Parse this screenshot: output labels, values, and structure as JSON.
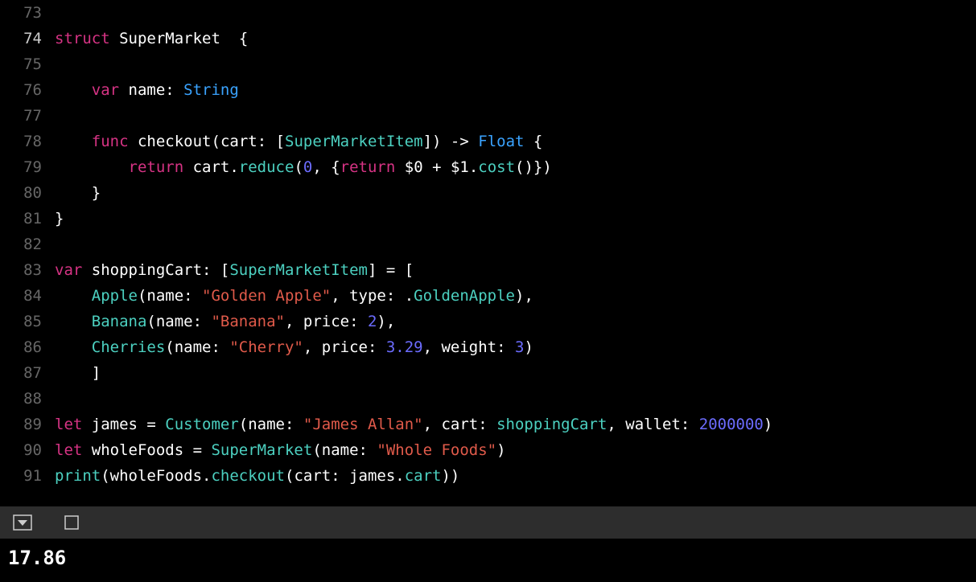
{
  "editor": {
    "first_line_no": 73,
    "lines": [
      {
        "no": 73,
        "tokens": []
      },
      {
        "no": 74,
        "tokens": [
          {
            "t": "struct",
            "c": "tok-keyword"
          },
          {
            "t": " ",
            "c": "tok-plain"
          },
          {
            "t": "SuperMarket",
            "c": "tok-plain"
          },
          {
            "t": "  {",
            "c": "tok-plain"
          }
        ]
      },
      {
        "no": 75,
        "tokens": []
      },
      {
        "no": 76,
        "tokens": [
          {
            "t": "    ",
            "c": "tok-plain"
          },
          {
            "t": "var",
            "c": "tok-keyword"
          },
          {
            "t": " name: ",
            "c": "tok-plain"
          },
          {
            "t": "String",
            "c": "tok-type"
          }
        ]
      },
      {
        "no": 77,
        "tokens": []
      },
      {
        "no": 78,
        "tokens": [
          {
            "t": "    ",
            "c": "tok-plain"
          },
          {
            "t": "func",
            "c": "tok-keyword"
          },
          {
            "t": " ",
            "c": "tok-plain"
          },
          {
            "t": "checkout",
            "c": "tok-plain"
          },
          {
            "t": "(cart: [",
            "c": "tok-plain"
          },
          {
            "t": "SuperMarketItem",
            "c": "tok-typedef"
          },
          {
            "t": "]) -> ",
            "c": "tok-plain"
          },
          {
            "t": "Float",
            "c": "tok-type"
          },
          {
            "t": " {",
            "c": "tok-plain"
          }
        ]
      },
      {
        "no": 79,
        "tokens": [
          {
            "t": "        ",
            "c": "tok-plain"
          },
          {
            "t": "return",
            "c": "tok-keyword"
          },
          {
            "t": " cart.",
            "c": "tok-plain"
          },
          {
            "t": "reduce",
            "c": "tok-fn"
          },
          {
            "t": "(",
            "c": "tok-plain"
          },
          {
            "t": "0",
            "c": "tok-num"
          },
          {
            "t": ", {",
            "c": "tok-plain"
          },
          {
            "t": "return",
            "c": "tok-keyword"
          },
          {
            "t": " $0 + $1.",
            "c": "tok-plain"
          },
          {
            "t": "cost",
            "c": "tok-fn"
          },
          {
            "t": "()})",
            "c": "tok-plain"
          }
        ]
      },
      {
        "no": 80,
        "tokens": [
          {
            "t": "    }",
            "c": "tok-plain"
          }
        ]
      },
      {
        "no": 81,
        "tokens": [
          {
            "t": "}",
            "c": "tok-plain"
          }
        ]
      },
      {
        "no": 82,
        "tokens": []
      },
      {
        "no": 83,
        "tokens": [
          {
            "t": "var",
            "c": "tok-keyword"
          },
          {
            "t": " shoppingCart: [",
            "c": "tok-plain"
          },
          {
            "t": "SuperMarketItem",
            "c": "tok-typedef"
          },
          {
            "t": "] = [",
            "c": "tok-plain"
          }
        ]
      },
      {
        "no": 84,
        "tokens": [
          {
            "t": "    ",
            "c": "tok-plain"
          },
          {
            "t": "Apple",
            "c": "tok-typedef"
          },
          {
            "t": "(name: ",
            "c": "tok-plain"
          },
          {
            "t": "\"Golden Apple\"",
            "c": "tok-str"
          },
          {
            "t": ", type: .",
            "c": "tok-plain"
          },
          {
            "t": "GoldenApple",
            "c": "tok-typedef"
          },
          {
            "t": "),",
            "c": "tok-plain"
          }
        ]
      },
      {
        "no": 85,
        "tokens": [
          {
            "t": "    ",
            "c": "tok-plain"
          },
          {
            "t": "Banana",
            "c": "tok-typedef"
          },
          {
            "t": "(name: ",
            "c": "tok-plain"
          },
          {
            "t": "\"Banana\"",
            "c": "tok-str"
          },
          {
            "t": ", price: ",
            "c": "tok-plain"
          },
          {
            "t": "2",
            "c": "tok-num"
          },
          {
            "t": "),",
            "c": "tok-plain"
          }
        ]
      },
      {
        "no": 86,
        "tokens": [
          {
            "t": "    ",
            "c": "tok-plain"
          },
          {
            "t": "Cherries",
            "c": "tok-typedef"
          },
          {
            "t": "(name: ",
            "c": "tok-plain"
          },
          {
            "t": "\"Cherry\"",
            "c": "tok-str"
          },
          {
            "t": ", price: ",
            "c": "tok-plain"
          },
          {
            "t": "3.29",
            "c": "tok-num"
          },
          {
            "t": ", weight: ",
            "c": "tok-plain"
          },
          {
            "t": "3",
            "c": "tok-num"
          },
          {
            "t": ")",
            "c": "tok-plain"
          }
        ]
      },
      {
        "no": 87,
        "tokens": [
          {
            "t": "    ]",
            "c": "tok-plain"
          }
        ]
      },
      {
        "no": 88,
        "tokens": []
      },
      {
        "no": 89,
        "tokens": [
          {
            "t": "let",
            "c": "tok-keyword"
          },
          {
            "t": " james = ",
            "c": "tok-plain"
          },
          {
            "t": "Customer",
            "c": "tok-typedef"
          },
          {
            "t": "(name: ",
            "c": "tok-plain"
          },
          {
            "t": "\"James Allan\"",
            "c": "tok-str"
          },
          {
            "t": ", cart: ",
            "c": "tok-plain"
          },
          {
            "t": "shoppingCart",
            "c": "tok-typedef"
          },
          {
            "t": ", wallet: ",
            "c": "tok-plain"
          },
          {
            "t": "2000000",
            "c": "tok-num"
          },
          {
            "t": ")",
            "c": "tok-plain"
          }
        ]
      },
      {
        "no": 90,
        "tokens": [
          {
            "t": "let",
            "c": "tok-keyword"
          },
          {
            "t": " wholeFoods = ",
            "c": "tok-plain"
          },
          {
            "t": "SuperMarket",
            "c": "tok-typedef"
          },
          {
            "t": "(name: ",
            "c": "tok-plain"
          },
          {
            "t": "\"Whole Foods\"",
            "c": "tok-str"
          },
          {
            "t": ")",
            "c": "tok-plain"
          }
        ]
      },
      {
        "no": 91,
        "tokens": [
          {
            "t": "print",
            "c": "tok-fn"
          },
          {
            "t": "(wholeFoods.",
            "c": "tok-plain"
          },
          {
            "t": "checkout",
            "c": "tok-fn"
          },
          {
            "t": "(cart: james.",
            "c": "tok-plain"
          },
          {
            "t": "cart",
            "c": "tok-typedef"
          },
          {
            "t": "))",
            "c": "tok-plain"
          }
        ]
      }
    ]
  },
  "console": {
    "output": "17.86"
  }
}
